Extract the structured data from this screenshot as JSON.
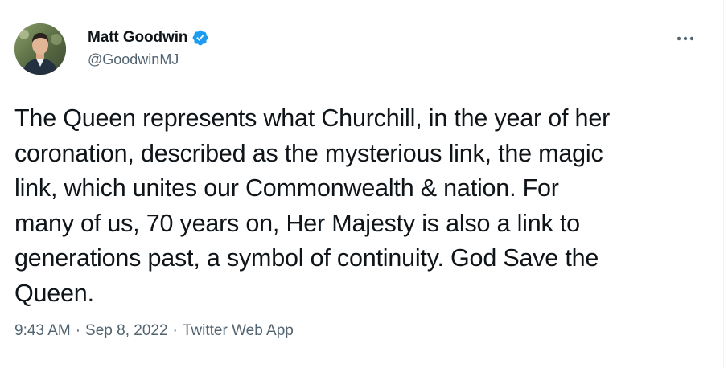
{
  "author": {
    "display_name": "Matt Goodwin",
    "handle": "@GoodwinMJ",
    "verified": true,
    "verified_color": "#1d9bf0"
  },
  "tweet": {
    "text": "The Queen represents what Churchill, in the year of her\ncoronation, described as the mysterious link, the magic\nlink, which unites our Commonwealth & nation. For\nmany of us, 70 years on, Her Majesty is also a link to\ngenerations past, a symbol of continuity. God Save the\nQueen."
  },
  "meta": {
    "time": "9:43 AM",
    "separator": "·",
    "date": "Sep 8, 2022",
    "source": "Twitter Web App"
  },
  "icons": {
    "more": "more-horizontal-icon",
    "verified": "verified-badge-icon"
  },
  "colors": {
    "text_primary": "#0f1419",
    "text_secondary": "#536471"
  }
}
